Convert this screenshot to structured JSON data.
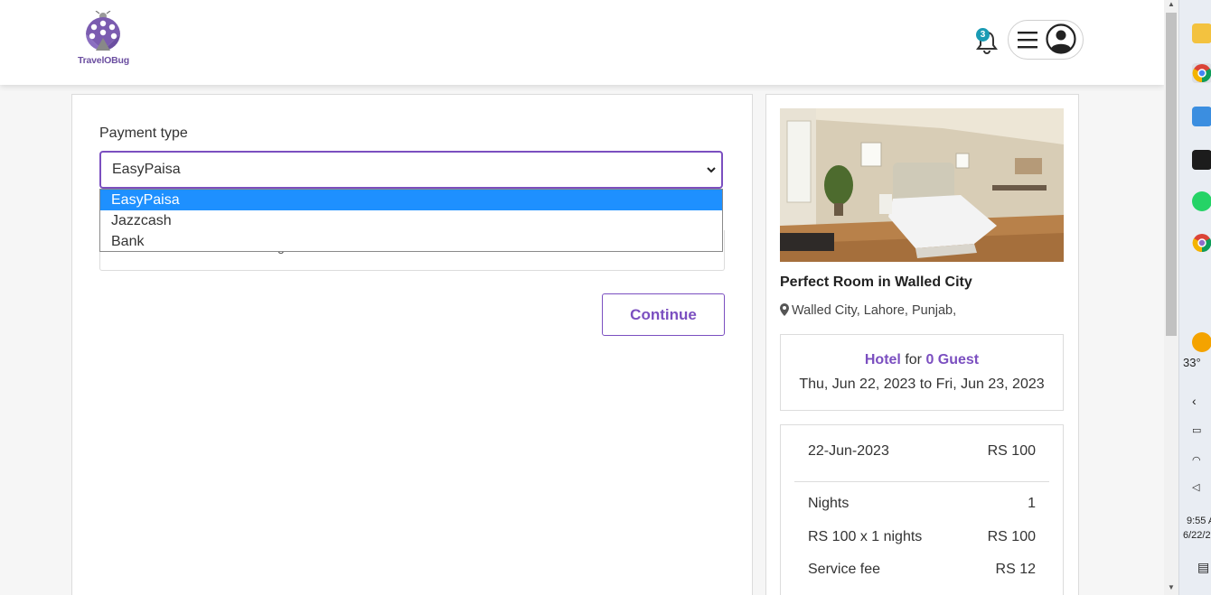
{
  "header": {
    "logo_text": "TravelOBug",
    "notification_count": "3"
  },
  "payment": {
    "label": "Payment type",
    "selected": "EasyPaisa",
    "options": [
      "EasyPaisa",
      "Jazzcash",
      "Bank"
    ],
    "hidden_text": "g",
    "continue_label": "Continue"
  },
  "listing": {
    "title": "Perfect Room in Walled City",
    "location": "Walled City, Lahore, Punjab,",
    "type": "Hotel",
    "for_text": "for",
    "guests": "0 Guest",
    "dates": "Thu, Jun 22, 2023 to Fri, Jun 23, 2023"
  },
  "pricing": {
    "rows": [
      {
        "label": "22-Jun-2023",
        "value": "RS 100"
      },
      {
        "label": "Nights",
        "value": "1"
      },
      {
        "label": "RS 100 x 1 nights",
        "value": "RS 100"
      },
      {
        "label": "Service fee",
        "value": "RS 12"
      }
    ]
  },
  "taskbar": {
    "weather": "33°",
    "time": "9:55 A",
    "date": "6/22/2"
  },
  "colors": {
    "accent": "#7b4fc0",
    "selected_option": "#1e90ff",
    "badge": "#1a9bb4"
  }
}
